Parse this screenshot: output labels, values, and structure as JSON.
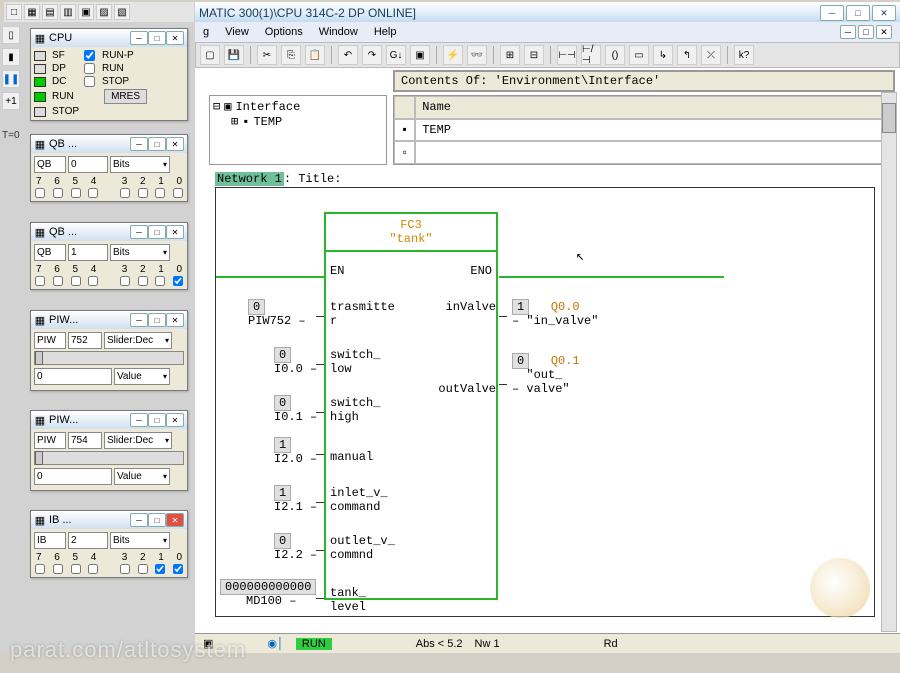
{
  "titlebar": {
    "text": "MATIC 300(1)\\CPU 314C-2 DP  ONLINE]"
  },
  "menubar": {
    "items": [
      "g",
      "View",
      "Options",
      "Window",
      "Help"
    ]
  },
  "toolbar": {
    "icons": [
      "open",
      "back",
      "fwd",
      "up",
      "find",
      "zoom",
      "undo",
      "redo",
      "|",
      "cut",
      "copy",
      "paste",
      "|",
      "run",
      "stop",
      "|",
      "fb1",
      "fb2",
      "|",
      "ld1",
      "ld2",
      "ld3",
      "ld4",
      "ld5",
      "ld6",
      "ld7",
      "ld8",
      "help"
    ]
  },
  "left": {
    "t0": "T=0",
    "cpu_window": {
      "title": "CPU",
      "status": [
        {
          "label": "SF",
          "color": "bg"
        },
        {
          "label": "DP",
          "color": "bg"
        },
        {
          "label": "DC",
          "color": "green"
        },
        {
          "label": "RUN",
          "color": "green"
        },
        {
          "label": "STOP",
          "color": "bg"
        }
      ],
      "modes": [
        {
          "label": "RUN-P",
          "checked": true
        },
        {
          "label": "RUN",
          "checked": false
        },
        {
          "label": "STOP",
          "checked": false
        }
      ],
      "mres": "MRES"
    },
    "qb0": {
      "title": "QB ...",
      "addr": "QB",
      "num": "0",
      "fmt": "Bits",
      "bits": [
        "7",
        "6",
        "5",
        "4",
        "3",
        "2",
        "1",
        "0"
      ]
    },
    "qb1": {
      "title": "QB ...",
      "addr": "QB",
      "num": "1",
      "fmt": "Bits",
      "bits": [
        "7",
        "6",
        "5",
        "4",
        "3",
        "2",
        "1",
        "0"
      ]
    },
    "piw752": {
      "title": "PIW...",
      "addr": "PIW",
      "num": "752",
      "fmt": "Slider:Dec",
      "val": "0",
      "valfmt": "Value"
    },
    "piw754": {
      "title": "PIW...",
      "addr": "PIW",
      "num": "754",
      "fmt": "Slider:Dec",
      "val": "0",
      "valfmt": "Value"
    },
    "ib2": {
      "title": "IB ...",
      "addr": "IB",
      "num": "2",
      "fmt": "Bits",
      "bits": [
        "7",
        "6",
        "5",
        "4",
        "3",
        "2",
        "1",
        "0"
      ]
    }
  },
  "main": {
    "contents_of": "Contents Of: 'Environment\\Interface'",
    "name_header": "Name",
    "temp_label": "TEMP",
    "tree": {
      "interface": "Interface",
      "temp": "TEMP"
    },
    "network": {
      "label": "Network 1",
      "title_prefix": ": Title:"
    },
    "block": {
      "name": "FC3",
      "instance": "\"tank\"",
      "en": "EN",
      "eno": "ENO",
      "inputs": [
        {
          "addr": "PIW752",
          "val": "0",
          "port": "trasmitte",
          "port2": "r"
        },
        {
          "addr": "I0.0",
          "val": "0",
          "port": "switch_",
          "port2": "low"
        },
        {
          "addr": "I0.1",
          "val": "0",
          "port": "switch_",
          "port2": "high"
        },
        {
          "addr": "I2.0",
          "val": "1",
          "port": "manual",
          "port2": ""
        },
        {
          "addr": "I2.1",
          "val": "1",
          "port": "inlet_v_",
          "port2": "command"
        },
        {
          "addr": "I2.2",
          "val": "0",
          "port": "outlet_v_",
          "port2": "commnd"
        },
        {
          "addr": "MD100",
          "val": "000000000000",
          "port": "tank_",
          "port2": "level",
          "extra": "000000000000"
        }
      ],
      "outputs": [
        {
          "addr": "Q0.0",
          "val": "1",
          "port": "inValve",
          "sym": "\"in_valve\""
        },
        {
          "addr": "Q0.1",
          "val": "0",
          "port": "outValve",
          "sym": "\"out_",
          "sym2": "valve\""
        }
      ]
    },
    "statusbar": {
      "run": "RUN",
      "abs": "Abs < 5.2",
      "nw": "Nw 1",
      "rd": "Rd"
    }
  },
  "watermark": "parat.com/atltosystem"
}
